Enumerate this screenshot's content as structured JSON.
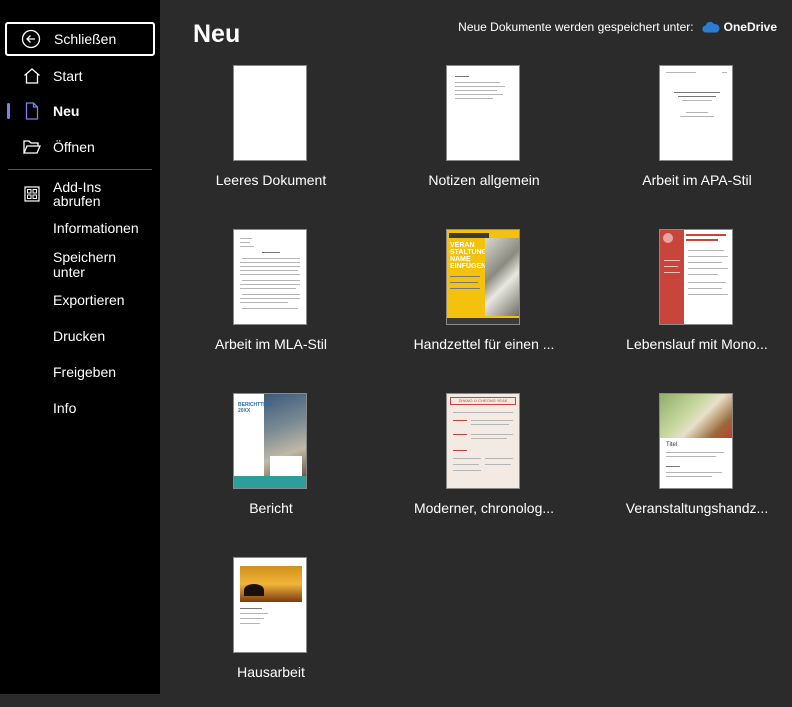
{
  "sidebar": {
    "close_label": "Schließen",
    "items": [
      {
        "label": "Start",
        "icon": "home-icon"
      },
      {
        "label": "Neu",
        "icon": "new-document-icon",
        "active": true
      },
      {
        "label": "Öffnen",
        "icon": "folder-open-icon"
      },
      {
        "label": "Add-Ins abrufen",
        "icon": "addins-grid-icon"
      }
    ],
    "sub_items": [
      "Informationen",
      "Speichern unter",
      "Exportieren",
      "Drucken",
      "Freigeben",
      "Info"
    ]
  },
  "main": {
    "title": "Neu",
    "save_note": "Neue Dokumente werden gespeichert unter:",
    "save_location": "OneDrive",
    "templates": [
      {
        "label": "Leeres Dokument"
      },
      {
        "label": "Notizen allgemein"
      },
      {
        "label": "Arbeit im APA-Stil"
      },
      {
        "label": "Arbeit im MLA-Stil"
      },
      {
        "label": "Handzettel für einen ..."
      },
      {
        "label": "Lebenslauf mit Mono..."
      },
      {
        "label": "Bericht",
        "thumb_text": "BERICHTTITEL 20XX"
      },
      {
        "label": "Moderner, chronolog..."
      },
      {
        "label": "Veranstaltungshandz..."
      },
      {
        "label": "Hausarbeit"
      }
    ],
    "flyer_text": "VERAN STALTUNG NAME EINFÜGEN",
    "cv_header_name": "ZHANG LI CHEONG YEAK",
    "event_title": "Titel"
  },
  "colors": {
    "accent": "#7b83eb",
    "onedrive": "#2b7cd3",
    "teal": "#2e9e9a",
    "flyer": "#f4c20d",
    "cv_red": "#c9443a"
  }
}
